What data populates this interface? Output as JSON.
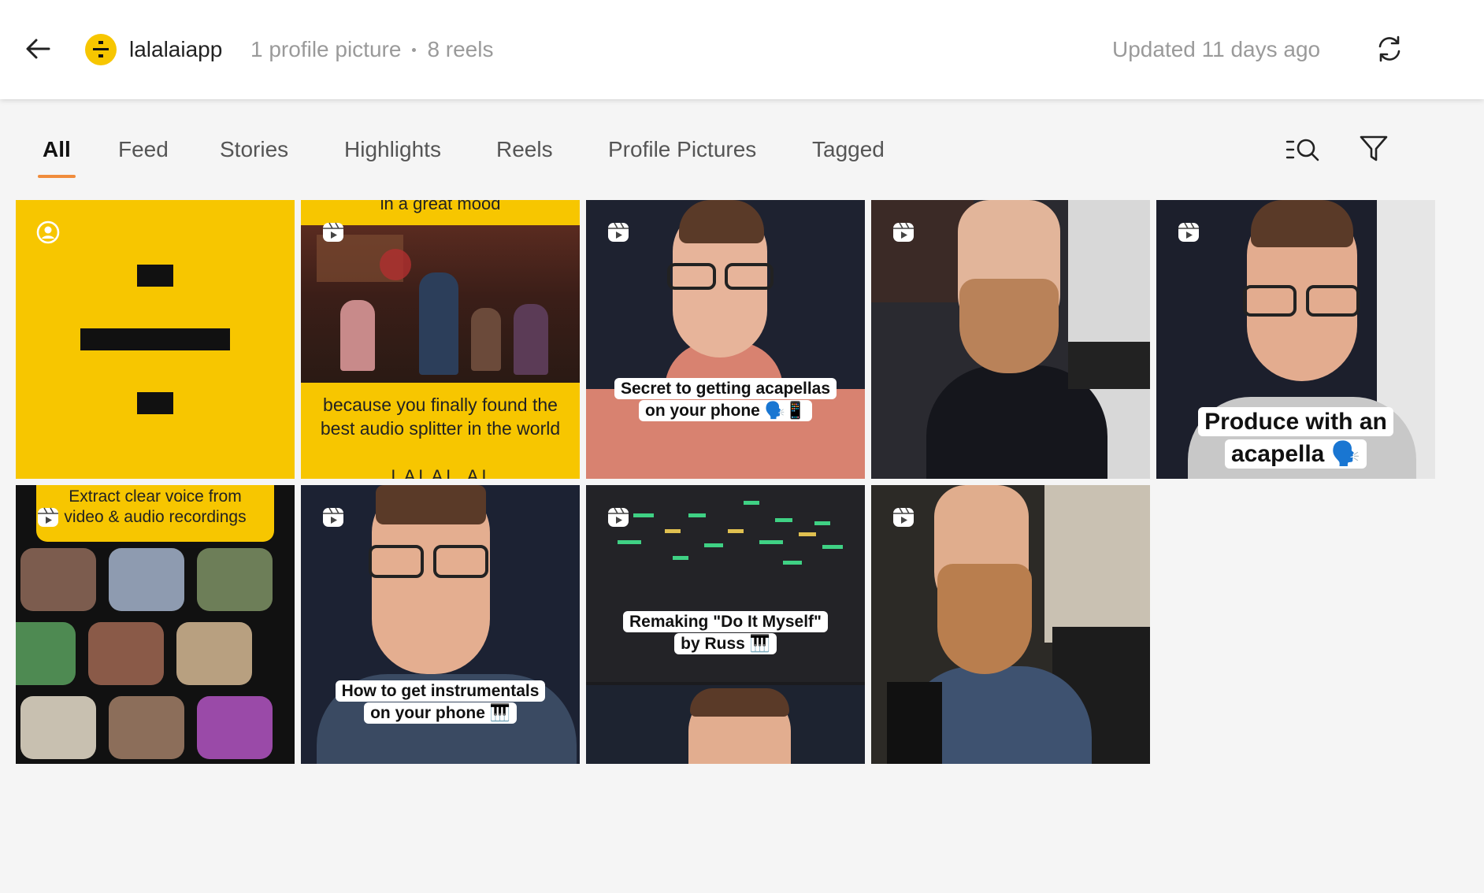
{
  "header": {
    "username": "lalalaiapp",
    "profile_pictures": "1 profile picture",
    "reels": "8 reels",
    "updated": "Updated 11 days ago"
  },
  "tabs": [
    {
      "label": "All",
      "active": true
    },
    {
      "label": "Feed",
      "active": false
    },
    {
      "label": "Stories",
      "active": false
    },
    {
      "label": "Highlights",
      "active": false
    },
    {
      "label": "Reels",
      "active": false
    },
    {
      "label": "Profile Pictures",
      "active": false
    },
    {
      "label": "Tagged",
      "active": false
    }
  ],
  "colors": {
    "brand_yellow": "#f7c600",
    "accent_orange": "#f08c3c",
    "muted_text": "#9a9a9a"
  },
  "media": [
    {
      "type": "profile-picture",
      "badge": "user-icon"
    },
    {
      "type": "reel",
      "badge": "reel-icon",
      "top_text": "in a great mood",
      "caption": "because you finally found the best audio splitter in the world",
      "bottom_text": "LALAL.AI"
    },
    {
      "type": "reel",
      "badge": "reel-icon",
      "caption_line1": "Secret to getting acapellas",
      "caption_line2": "on your phone 🗣️📱"
    },
    {
      "type": "reel",
      "badge": "reel-icon"
    },
    {
      "type": "reel",
      "badge": "reel-icon",
      "caption_line1": "Produce with an",
      "caption_line2": "acapella 🗣️"
    },
    {
      "type": "reel",
      "badge": "reel-icon",
      "caption_line1": "Extract clear voice from",
      "caption_line2": "video & audio recordings"
    },
    {
      "type": "reel",
      "badge": "reel-icon",
      "caption_line1": "How to get instrumentals",
      "caption_line2": "on your phone 🎹"
    },
    {
      "type": "reel",
      "badge": "reel-icon",
      "caption_line1": "Remaking \"Do It Myself\"",
      "caption_line2": "by Russ 🎹"
    },
    {
      "type": "reel",
      "badge": "reel-icon"
    }
  ]
}
